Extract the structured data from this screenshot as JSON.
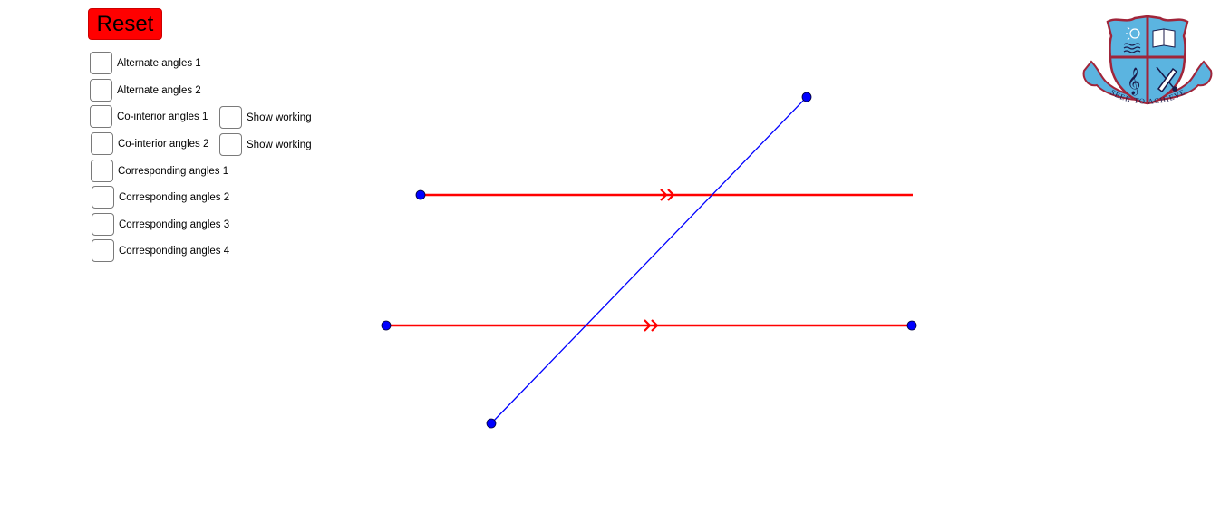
{
  "toolbar": {
    "reset_label": "Reset",
    "reset_color": "#ff0000"
  },
  "checkboxes": [
    {
      "label": "Alternate angles 1",
      "checked": false
    },
    {
      "label": "Alternate angles 2",
      "checked": false
    },
    {
      "label": "Co-interior angles 1",
      "checked": false
    },
    {
      "label": "Co-interior angles 2",
      "checked": false
    },
    {
      "label": "Corresponding angles 1",
      "checked": false
    },
    {
      "label": "Corresponding angles 2",
      "checked": false
    },
    {
      "label": "Corresponding angles 3",
      "checked": false
    },
    {
      "label": "Corresponding angles 4",
      "checked": false
    }
  ],
  "show_working": [
    {
      "label": "Show working",
      "for": "Co-interior angles 1",
      "checked": false
    },
    {
      "label": "Show working",
      "for": "Co-interior angles 2",
      "checked": false
    }
  ],
  "construction": {
    "parallel_line_color": "#ff0000",
    "transversal_color": "#0000ff",
    "point_color": "#0000ff",
    "parallel_marker": "double-chevron"
  },
  "logo": {
    "motto": "SEEK TO ACHIEVE",
    "shield_color": "#5bb4e0",
    "border_color": "#a0253a"
  }
}
